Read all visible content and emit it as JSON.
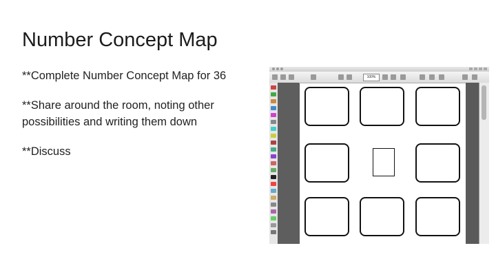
{
  "slide": {
    "title": "Number Concept Map",
    "bullets": [
      "**Complete Number Concept Map for 36",
      "**Share around the room, noting other possibilities and writing them down",
      "**Discuss"
    ]
  },
  "screenshot": {
    "zoom": "100%",
    "colors": {
      "background": "#5b5b5b",
      "page": "#ffffff",
      "border": "#111111"
    }
  }
}
